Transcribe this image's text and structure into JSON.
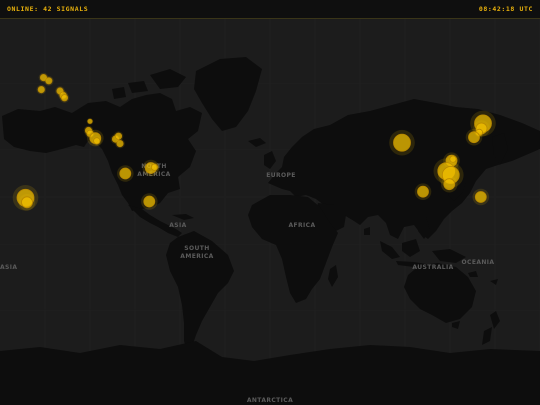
{
  "header": {
    "status": "ONLINE: 42 SIGNALS",
    "clock": "08:42:18 UTC"
  },
  "colors": {
    "accent": "#e8b10c",
    "marker_fill": "#f2c100",
    "marker_stroke": "#b98800",
    "land": "#0d0d0d",
    "ocean": "#1c1c1c",
    "label": "#5b5b5b"
  },
  "map": {
    "projection": "mercator",
    "labels": {
      "north_america_1": "NORTH",
      "north_america_2": "AMERICA",
      "south_america_1": "SOUTH",
      "south_america_2": "AMERICA",
      "europe": "EUROPE",
      "africa": "AFRICA",
      "asia": "ASIA",
      "australia": "AUSTRALIA",
      "oceania": "OCEANIA",
      "antarctica": "ANTARCTICA"
    },
    "signals": [
      {
        "lon": -151.0,
        "lat": 62.0,
        "size": "small"
      },
      {
        "lon": -152.5,
        "lat": 58.0,
        "size": "small"
      },
      {
        "lon": -147.5,
        "lat": 61.0,
        "size": "small"
      },
      {
        "lon": -140.0,
        "lat": 57.5,
        "size": "small"
      },
      {
        "lon": -138.0,
        "lat": 56.0,
        "size": "small"
      },
      {
        "lon": -137.0,
        "lat": 55.0,
        "size": "small"
      },
      {
        "lon": -120.0,
        "lat": 45.0,
        "size": "tiny"
      },
      {
        "lon": -121.0,
        "lat": 40.5,
        "size": "small"
      },
      {
        "lon": -120.0,
        "lat": 39.0,
        "size": "small"
      },
      {
        "lon": -116.5,
        "lat": 36.5,
        "size": "medium"
      },
      {
        "lon": -115.5,
        "lat": 35.0,
        "size": "small"
      },
      {
        "lon": -103.0,
        "lat": 36.0,
        "size": "small"
      },
      {
        "lon": -101.0,
        "lat": 37.5,
        "size": "small"
      },
      {
        "lon": -100.0,
        "lat": 33.5,
        "size": "small"
      },
      {
        "lon": -96.5,
        "lat": 15.5,
        "size": "medium"
      },
      {
        "lon": -79.5,
        "lat": 19.0,
        "size": "medium"
      },
      {
        "lon": -77.0,
        "lat": 19.5,
        "size": "small"
      },
      {
        "lon": -80.5,
        "lat": -3.0,
        "size": "medium"
      },
      {
        "lon": -163.0,
        "lat": -0.5,
        "size": "large"
      },
      {
        "lon": -162.0,
        "lat": -3.5,
        "size": "medium"
      },
      {
        "lon": 88.0,
        "lat": 34.0,
        "size": "large"
      },
      {
        "lon": 142.0,
        "lat": 44.0,
        "size": "large"
      },
      {
        "lon": 141.0,
        "lat": 41.5,
        "size": "medium"
      },
      {
        "lon": 139.5,
        "lat": 39.5,
        "size": "small"
      },
      {
        "lon": 136.0,
        "lat": 37.0,
        "size": "medium"
      },
      {
        "lon": 121.0,
        "lat": 23.5,
        "size": "medium"
      },
      {
        "lon": 122.0,
        "lat": 24.5,
        "size": "small"
      },
      {
        "lon": 117.5,
        "lat": 17.0,
        "size": "large"
      },
      {
        "lon": 120.5,
        "lat": 14.5,
        "size": "large"
      },
      {
        "lon": 119.5,
        "lat": 8.5,
        "size": "medium"
      },
      {
        "lon": 102.0,
        "lat": 3.5,
        "size": "medium"
      },
      {
        "lon": 140.5,
        "lat": 0.0,
        "size": "medium"
      }
    ]
  }
}
